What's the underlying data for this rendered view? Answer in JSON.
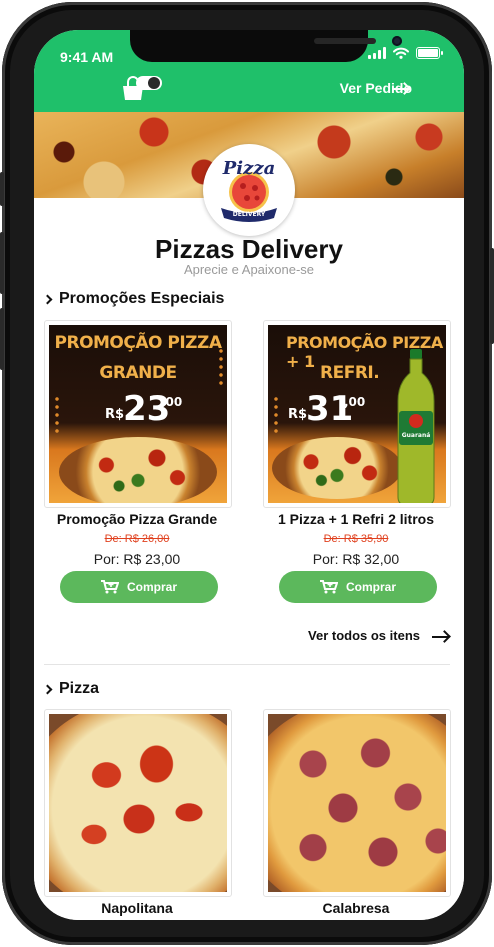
{
  "status_bar": {
    "time": "9:41 AM"
  },
  "header": {
    "order_link": "Ver Pedido"
  },
  "store": {
    "name": "Pizzas Delivery",
    "tagline": "Aprecie e Apaixone-se",
    "logo_text": "Pizza",
    "logo_badge": "DELIVERY"
  },
  "sections": {
    "promotions": {
      "title": "Promoções Especiais",
      "items": [
        {
          "banner_line1": "PROMOÇÃO PIZZA",
          "banner_line2": "GRANDE",
          "banner_currency": "R$",
          "banner_price": "23",
          "banner_cents": ",00",
          "name": "Promoção Pizza Grande",
          "old_price": "De: R$ 26,00",
          "new_price": "Por: R$ 23,00",
          "buy_label": "Comprar"
        },
        {
          "banner_line1": "PROMOÇÃO PIZZA + 1",
          "banner_line2": "REFRI.",
          "banner_currency": "R$",
          "banner_price": "31",
          "banner_cents": ",00",
          "bottle_label": "Guaraná",
          "name": "1 Pizza + 1 Refri 2 litros",
          "old_price": "De: R$ 35,90",
          "new_price": "Por: R$ 32,00",
          "buy_label": "Comprar"
        }
      ],
      "see_all": "Ver todos os itens"
    },
    "pizza": {
      "title": "Pizza",
      "items": [
        {
          "name": "Napolitana"
        },
        {
          "name": "Calabresa"
        }
      ]
    }
  },
  "colors": {
    "brand_green": "#1fc06a",
    "button_green": "#5cb85c",
    "old_price_red": "#e0401e"
  }
}
